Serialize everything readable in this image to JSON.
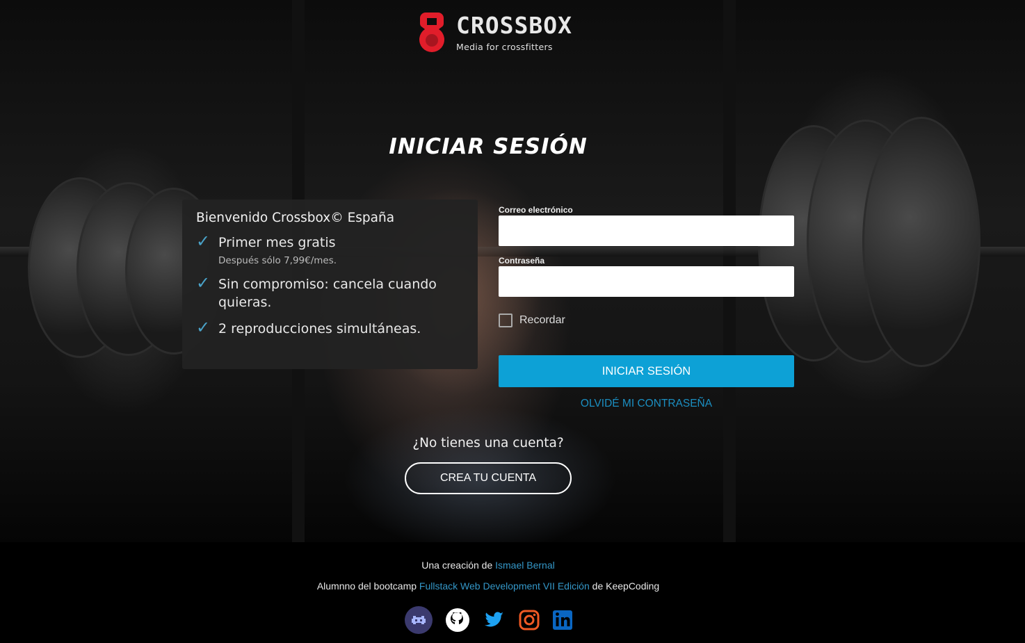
{
  "brand": {
    "name": "CROSSBOX",
    "tagline": "Media for crossfitters",
    "accent": "#e11d2a"
  },
  "page_title": "INICIAR SESIÓN",
  "benefits": {
    "heading": "Bienvenido Crossbox© España",
    "items": [
      {
        "text": "Primer mes gratis",
        "sub": "Después sólo 7,99€/mes."
      },
      {
        "text": "Sin compromiso: cancela cuando quieras.",
        "sub": ""
      },
      {
        "text": "2 reproducciones simultáneas.",
        "sub": ""
      }
    ],
    "check_color": "#4aa3c9"
  },
  "login_form": {
    "email_label": "Correo electrónico",
    "email_value": "",
    "password_label": "Contraseña",
    "password_value": "",
    "remember_label": "Recordar",
    "remember_checked": false,
    "submit_label": "INICIAR SESIÓN",
    "submit_color": "#0da1d6",
    "forgot_label": "OLVIDÉ MI CONTRASEÑA"
  },
  "signup": {
    "question": "¿No tienes una cuenta?",
    "button_label": "CREA TU CUENTA"
  },
  "footer": {
    "credit_prefix": "Una creación de ",
    "author": "Ismael Bernal",
    "bootcamp_prefix": "Alumnno del bootcamp ",
    "bootcamp_link": "Fullstack Web Development VII Edición",
    "bootcamp_suffix": " de KeepCoding",
    "link_color": "#3497c8",
    "social": [
      "space-invader-icon",
      "github-icon",
      "twitter-icon",
      "instagram-icon",
      "linkedin-icon"
    ]
  }
}
